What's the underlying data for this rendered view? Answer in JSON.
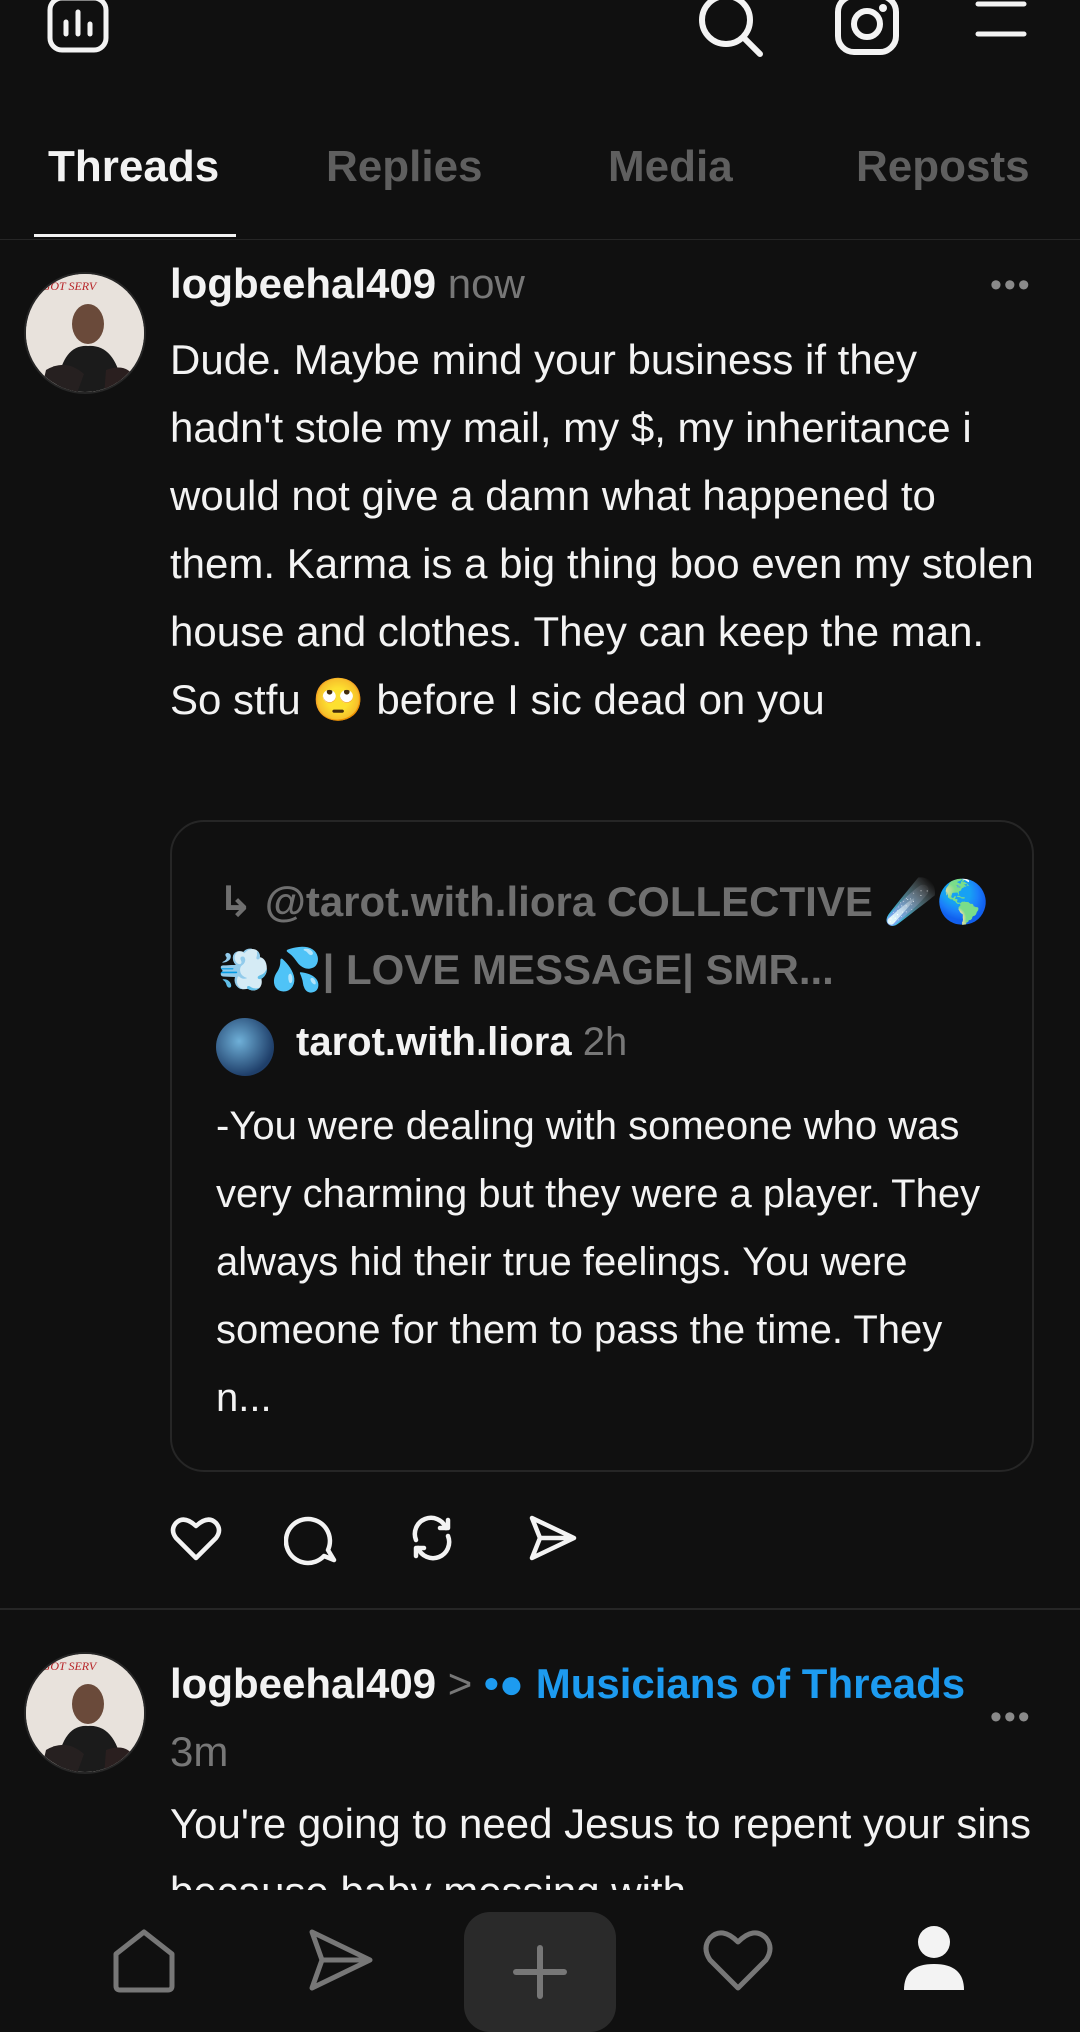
{
  "tabs": [
    "Threads",
    "Replies",
    "Media",
    "Reposts"
  ],
  "post1": {
    "username": "logbeehal409",
    "time": "now",
    "more": "•••",
    "body": "Dude. Maybe mind your business if they hadn't stole my mail, my $, my inheritance i would not give a damn what happened to them. Karma is a big thing boo even my stolen house and clothes.  They can keep the man. So stfu 🙄 before I sic dead on you",
    "quote": {
      "ref_arrow": "↳",
      "ref_text": "@tarot.with.liora COLLECTIVE ☄️🌎💨💦| LOVE MESSAGE| SMR...",
      "username": "tarot.with.liora",
      "time": "2h",
      "body": "-You were dealing with someone who was very charming but they were a player. They always hid their true feelings. You were someone for them to pass the time. They n..."
    }
  },
  "post2": {
    "username": "logbeehal409",
    "chevron": ">",
    "community_icon": "•●",
    "community": "Musicians of Threads",
    "time": "3m",
    "more": "•••",
    "body": "You're going to need Jesus to repent your sins because baby messing with"
  },
  "avatar_text": "U GOT SERV"
}
